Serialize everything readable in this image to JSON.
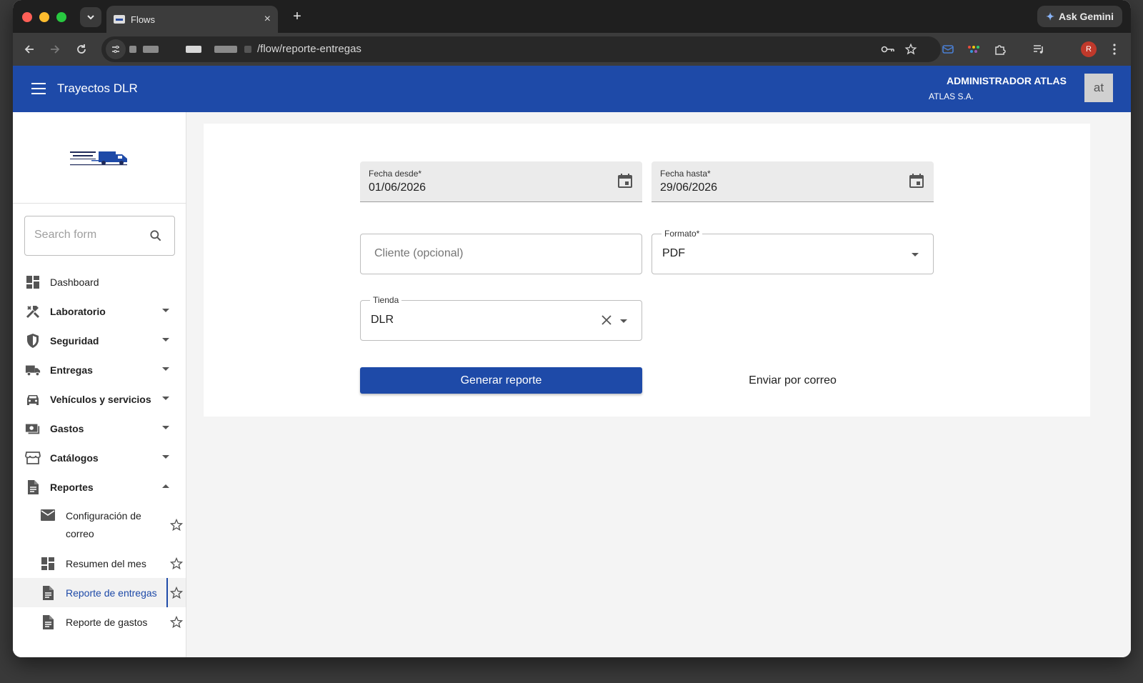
{
  "browser": {
    "tab_title": "Flows",
    "new_tab": "+",
    "close_tab": "×",
    "gemini_label": "Ask Gemini",
    "url": "/flow/reporte-entregas",
    "profile_initial": "R"
  },
  "header": {
    "app_title": "Trayectos DLR",
    "user_name": "ADMINISTRADOR ATLAS",
    "user_company": "ATLAS S.A.",
    "avatar_initials": "at",
    "bg_color": "#1e4aa8"
  },
  "sidebar": {
    "search_placeholder": "Search form",
    "items": [
      {
        "label": "Dashboard",
        "icon": "dashboard-icon",
        "expandable": false
      },
      {
        "label": "Laboratorio",
        "icon": "tools-icon",
        "expandable": true
      },
      {
        "label": "Seguridad",
        "icon": "shield-icon",
        "expandable": true
      },
      {
        "label": "Entregas",
        "icon": "truck-icon",
        "expandable": true
      },
      {
        "label": "Vehículos y servicios",
        "icon": "car-icon",
        "expandable": true
      },
      {
        "label": "Gastos",
        "icon": "money-icon",
        "expandable": true
      },
      {
        "label": "Catálogos",
        "icon": "store-icon",
        "expandable": true
      },
      {
        "label": "Reportes",
        "icon": "document-icon",
        "expandable": true,
        "expanded": true
      }
    ],
    "sub_items": [
      {
        "label": "Configuración de correo",
        "icon": "mail-icon"
      },
      {
        "label": "Resumen del mes",
        "icon": "dashboard-icon"
      },
      {
        "label": "Reporte de entregas",
        "icon": "document-icon",
        "active": true
      },
      {
        "label": "Reporte de gastos",
        "icon": "document-icon"
      }
    ]
  },
  "form": {
    "fecha_desde": {
      "label": "Fecha desde*",
      "value": "01/06/2026"
    },
    "fecha_hasta": {
      "label": "Fecha hasta*",
      "value": "29/06/2026"
    },
    "cliente": {
      "placeholder": "Cliente (opcional)"
    },
    "formato": {
      "label": "Formato*",
      "value": "PDF"
    },
    "tienda": {
      "label": "Tienda",
      "value": "DLR"
    },
    "generate_button": "Generar reporte",
    "email_button": "Enviar por correo"
  }
}
